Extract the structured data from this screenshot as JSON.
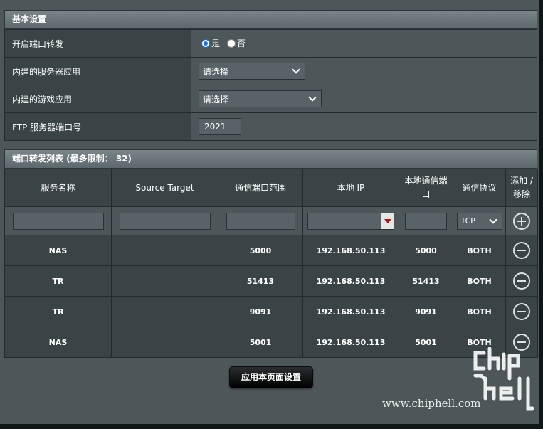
{
  "basic_settings": {
    "title": "基本设置",
    "rows": [
      {
        "label": "开启端口转发"
      },
      {
        "label": "内建的服务器应用",
        "select_value": "请选择"
      },
      {
        "label": "内建的游戏应用",
        "select_value": "请选择"
      },
      {
        "label": "FTP 服务器端口号",
        "input_value": "2021"
      }
    ],
    "radio_yes": "是",
    "radio_no": "否",
    "radio_selected": "是"
  },
  "forward_list": {
    "title": "端口转发列表 (最多限制： 32)",
    "headers": [
      "服务名称",
      "Source Target",
      "通信端口范围",
      "本地 IP",
      "本地通信端口",
      "通信协议",
      "添加 / 移除"
    ],
    "protocol_select": "TCP",
    "rows": [
      {
        "name": "NAS",
        "source": "",
        "port_range": "5000",
        "ip": "192.168.50.113",
        "local_port": "5000",
        "protocol": "BOTH"
      },
      {
        "name": "TR",
        "source": "",
        "port_range": "51413",
        "ip": "192.168.50.113",
        "local_port": "51413",
        "protocol": "BOTH"
      },
      {
        "name": "TR",
        "source": "",
        "port_range": "9091",
        "ip": "192.168.50.113",
        "local_port": "9091",
        "protocol": "BOTH"
      },
      {
        "name": "NAS",
        "source": "",
        "port_range": "5001",
        "ip": "192.168.50.113",
        "local_port": "5001",
        "protocol": "BOTH"
      }
    ]
  },
  "apply_button": "应用本页面设置",
  "watermark": {
    "url": "www.chiphell.com",
    "logo_text": "chip hell"
  },
  "icons": {
    "add": "plus-circle-icon",
    "remove": "minus-circle-icon",
    "dropdown": "chevron-down-icon"
  }
}
